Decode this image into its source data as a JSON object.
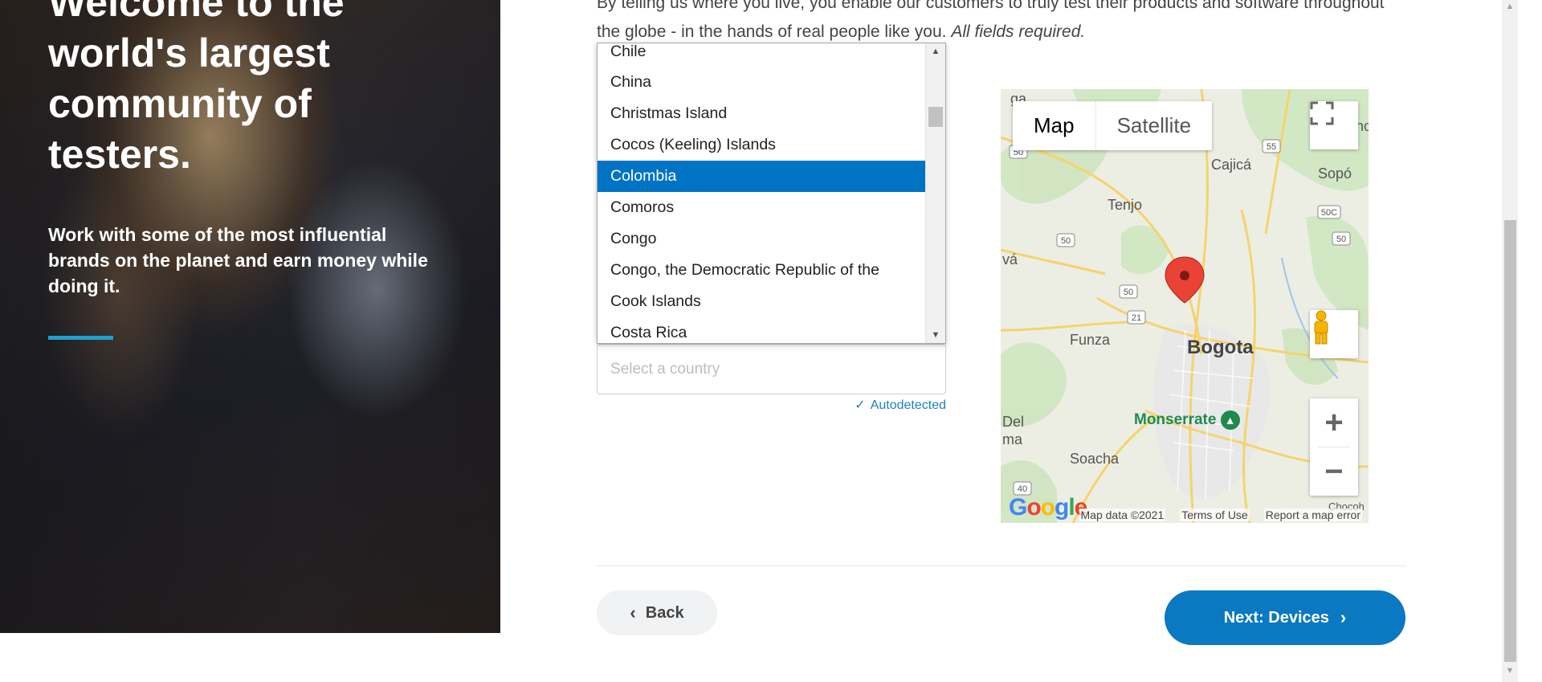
{
  "hero": {
    "title": "Welcome to the world's largest community of testers.",
    "subtitle": "Work with some of the most influential brands on the planet and earn money while doing it."
  },
  "intro": {
    "text": "By telling us where you live, you enable our customers to truly test their products and software throughout the globe - in the hands of real people like you.",
    "required": "All fields required."
  },
  "country": {
    "placeholder": "Select a country",
    "autodetected": "Autodetected",
    "options": [
      "Chile",
      "China",
      "Christmas Island",
      "Cocos (Keeling) Islands",
      "Colombia",
      "Comoros",
      "Congo",
      "Congo, the Democratic Republic of the",
      "Cook Islands",
      "Costa Rica"
    ],
    "selected": "Colombia"
  },
  "map": {
    "type_map": "Map",
    "type_satellite": "Satellite",
    "zoom_in": "+",
    "zoom_out": "−",
    "logo": "Google",
    "footer": [
      "Map data ©2021",
      "Terms of Use",
      "Report a map error"
    ],
    "labels": {
      "bogota": "Bogota",
      "funza": "Funza",
      "soacha": "Soacha",
      "tenjo": "Tenjo",
      "cajica": "Cajicá",
      "sopo": "Sopó",
      "monserrate": "Monserrate",
      "del": "Del",
      "ma": "ma",
      "va": "vá",
      "ga": "ga",
      "no": "no",
      "chocoh": "Chocoh"
    },
    "route_shields": [
      "50",
      "55",
      "50C",
      "50",
      "50",
      "50",
      "21",
      "40"
    ]
  },
  "buttons": {
    "back": "Back",
    "next": "Next: Devices"
  },
  "colors": {
    "accent": "#0b78c2",
    "selected": "#0173c4",
    "hero_bar": "#1fa0d0",
    "autodetect": "#1b82bd"
  }
}
